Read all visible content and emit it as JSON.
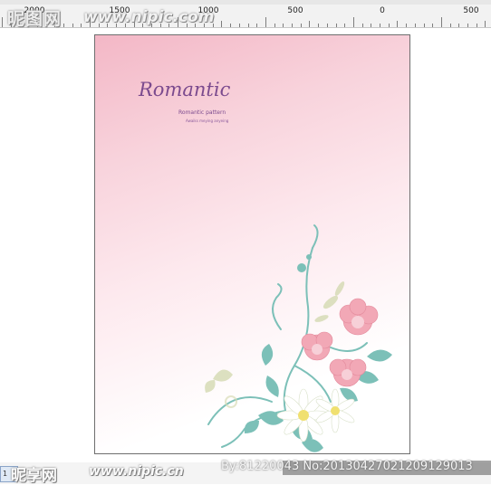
{
  "watermark_top": {
    "brand": "昵图网",
    "url": "www.nipic.com"
  },
  "ruler": {
    "labels": [
      "2000",
      "1500",
      "1000",
      "500",
      "0",
      "500"
    ]
  },
  "document": {
    "title": "Romantic",
    "subtitle": "Romantic pattern",
    "line": "Awaiks meying anyeing"
  },
  "watermark_bottom": {
    "brand": "昵享网",
    "url": "www.nipic.cn"
  },
  "image_id": "By:81220043 No:20130427021209129013",
  "page_tab": "1",
  "colors": {
    "title": "#7b4a8e",
    "page_border": "#6e6e6e",
    "ruler_bg": "#f2f2f2",
    "pink": "#f3b7c6"
  },
  "icons": {
    "flowers": "floral-corner-decoration"
  }
}
